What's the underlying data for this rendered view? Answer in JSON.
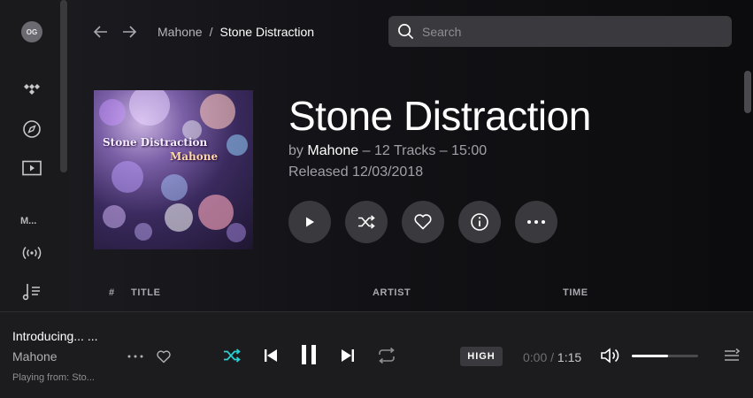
{
  "user": {
    "initials": "OG"
  },
  "sidebar": {
    "items": [
      {
        "icon": "tidal-logo-icon"
      },
      {
        "icon": "compass-icon"
      },
      {
        "icon": "video-icon"
      },
      {
        "label": "M..."
      },
      {
        "icon": "broadcast-icon"
      },
      {
        "icon": "playlist-icon"
      }
    ]
  },
  "breadcrumb": {
    "parent": "Mahone",
    "separator": "/",
    "current": "Stone Distraction"
  },
  "search": {
    "placeholder": "Search",
    "value": ""
  },
  "album": {
    "title": "Stone Distraction",
    "by_prefix": "by",
    "artist": "Mahone",
    "track_info": "– 12 Tracks – 15:00",
    "released": "Released 12/03/2018",
    "cover_title": "Stone Distraction",
    "cover_artist": "Mahone"
  },
  "table": {
    "headers": [
      "#",
      "TITLE",
      "ARTIST",
      "TIME"
    ]
  },
  "player": {
    "track_title": "Introducing... ...",
    "track_artist": "Mahone",
    "playing_from": "Playing from:  Sto...",
    "quality": "HIGH",
    "current_time": "0:00",
    "time_sep": "/",
    "total_time": "1:15",
    "volume": 0.55
  },
  "colors": {
    "accent": "#29d1d6",
    "background": "#101012",
    "button": "#3a3a3e"
  }
}
